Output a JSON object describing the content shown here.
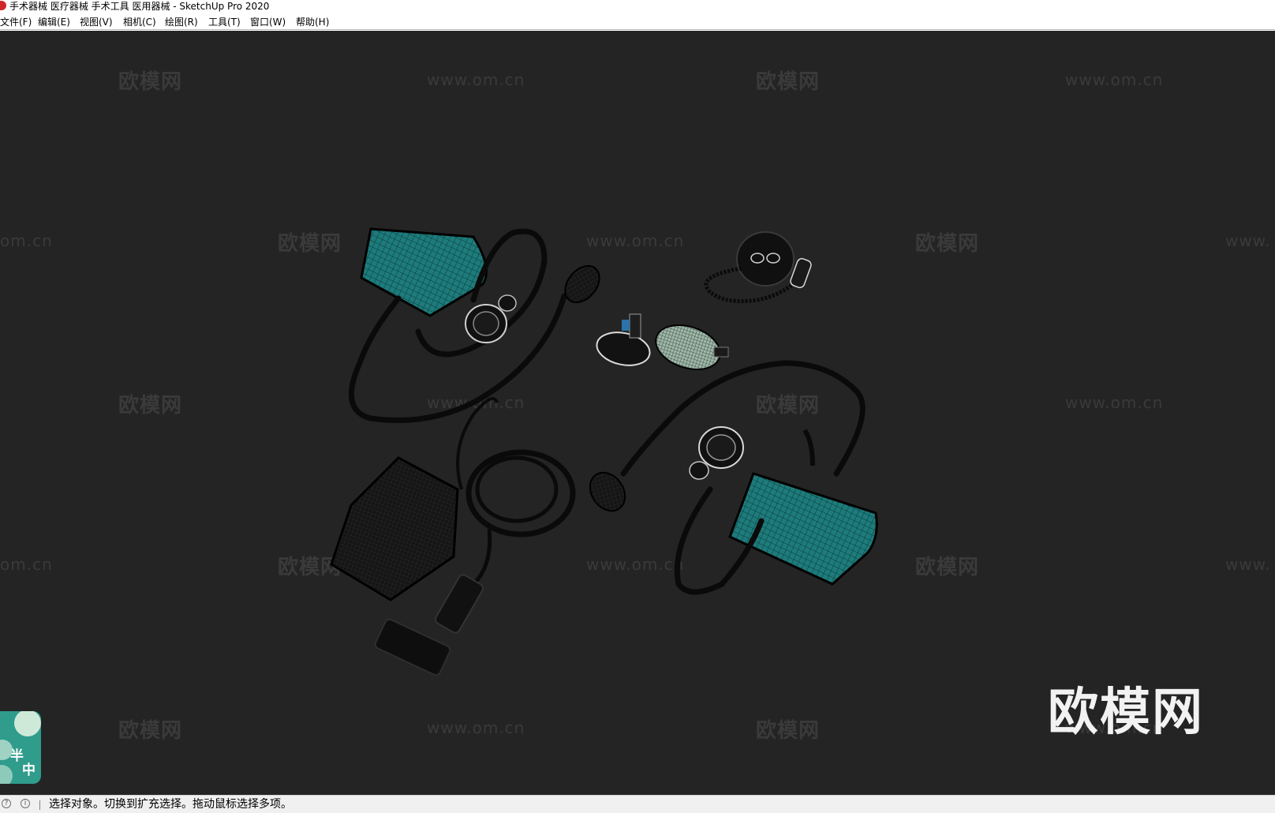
{
  "window": {
    "title": "手术器械 医疗器械 手术工具 医用器械 - SketchUp Pro 2020",
    "icon": "sketchup-logo-icon"
  },
  "menu": [
    {
      "label": "文件(F)"
    },
    {
      "label": "编辑(E)"
    },
    {
      "label": "视图(V)"
    },
    {
      "label": "相机(C)"
    },
    {
      "label": "绘图(R)"
    },
    {
      "label": "工具(T)"
    },
    {
      "label": "窗口(W)"
    },
    {
      "label": "帮助(H)"
    }
  ],
  "watermarks": {
    "brand": "欧模网",
    "url": "www.om.cn",
    "url_partial_left": "om.cn",
    "url_partial_right": "www.",
    "logo": "欧模网"
  },
  "badge": {
    "chars": [
      "半",
      "中"
    ]
  },
  "status": {
    "text": "选择对象。切换到扩充选择。拖动鼠标选择多项。",
    "icons": [
      "help-icon",
      "info-icon"
    ]
  },
  "colors": {
    "viewport_bg": "#242424",
    "cuff_fabric": "#1f7a7a",
    "wireframe": "#000000",
    "badge_bg": "#2f9c8c"
  }
}
